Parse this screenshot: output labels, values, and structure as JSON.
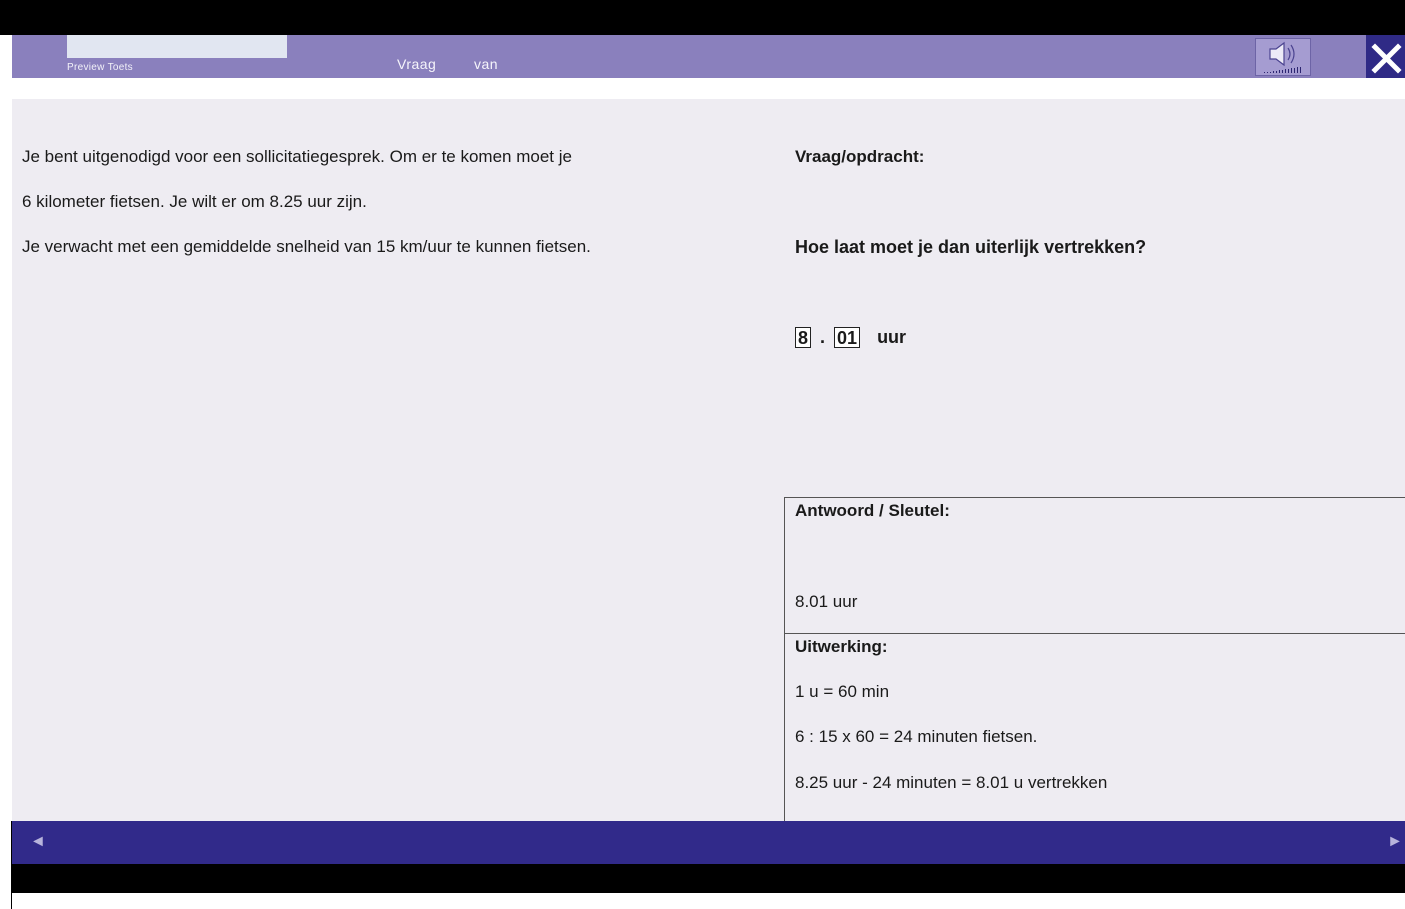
{
  "header": {
    "preview_label": "Preview Toets",
    "question_label": "Vraag",
    "of_label": "van",
    "close_label": "X"
  },
  "context": {
    "lines": [
      "Je bent uitgenodigd voor een sollicitatiegesprek. Om er te komen moet je",
      "6 kilometer fietsen.  Je wilt er om 8.25 uur zijn.",
      "Je verwacht met een gemiddelde snelheid van 15 km/uur te kunnen fietsen."
    ]
  },
  "question": {
    "heading": "Vraag/opdracht:",
    "text": "Hoe laat moet je dan uiterlijk vertrekken?",
    "hours_value": "8",
    "separator": ".",
    "minutes_value": "01",
    "unit": "uur"
  },
  "key": {
    "heading": "Antwoord / Sleutel:",
    "answer": "8.01 uur"
  },
  "work": {
    "heading": "Uitwerking:",
    "lines": [
      "1 u = 60 min",
      "6 : 15 x 60 = 24 minuten fietsen.",
      "8.25 uur - 24 minuten = 8.01 u vertrekken"
    ]
  },
  "footer": {
    "prev_label": "◄",
    "next_label": "►"
  },
  "colors": {
    "header_bg": "#8a80bd",
    "footer_bg": "#312a8a",
    "content_bg": "#eeecf2"
  }
}
